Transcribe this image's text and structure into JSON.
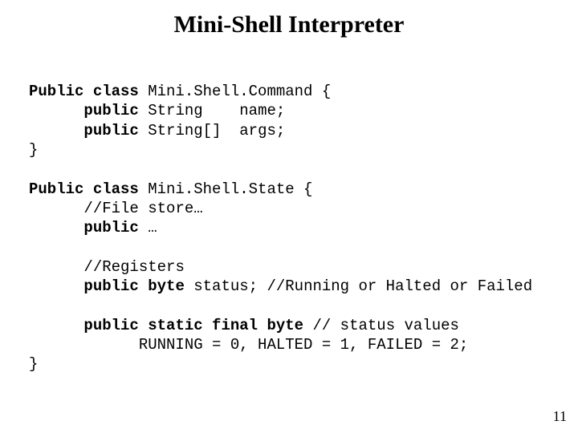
{
  "title": "Mini-Shell Interpreter",
  "code": {
    "c1_kw1": "Public class",
    "c1_rest": " Mini.Shell.Command {",
    "c1_f1_kw": "public",
    "c1_f1_rest": " String    name;",
    "c1_f2_kw": "public",
    "c1_f2_rest": " String[]  args;",
    "c1_close": "}",
    "c2_kw1": "Public class",
    "c2_rest": " Mini.Shell.State {",
    "c2_cmnt1": "//File store…",
    "c2_f1_kw": "public",
    "c2_f1_rest": " …",
    "c2_cmnt2": "//Registers",
    "c2_f2_kw": "public byte",
    "c2_f2_rest": " status; //Running or Halted or Failed",
    "c2_f3_kw": "public static final byte",
    "c2_f3_rest": " // status values",
    "c2_f3_vals": "RUNNING = 0, HALTED = 1, FAILED = 2;",
    "c2_close": "}"
  },
  "page_number": "11"
}
